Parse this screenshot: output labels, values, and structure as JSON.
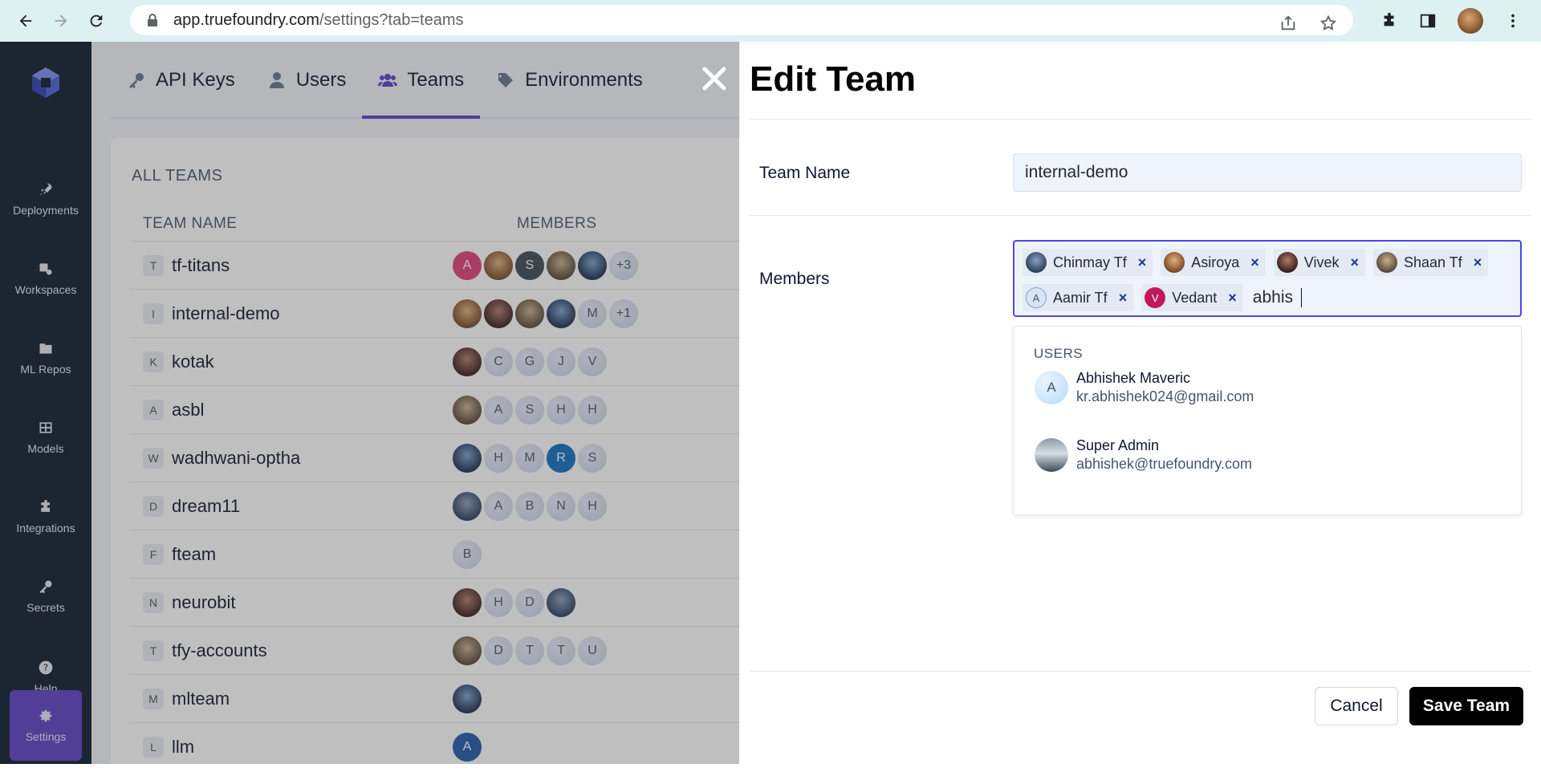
{
  "browser": {
    "url_host": "app.truefoundry.com",
    "url_path": "/settings?tab=teams"
  },
  "sidebar": {
    "items": [
      {
        "label": "Deployments",
        "icon": "rocket-icon"
      },
      {
        "label": "Workspaces",
        "icon": "workspaces-icon"
      },
      {
        "label": "ML Repos",
        "icon": "folder-icon"
      },
      {
        "label": "Models",
        "icon": "table-icon"
      },
      {
        "label": "Integrations",
        "icon": "puzzle-icon"
      },
      {
        "label": "Secrets",
        "icon": "key-icon"
      },
      {
        "label": "Help",
        "icon": "help-icon"
      },
      {
        "label": "Settings",
        "icon": "gear-icon",
        "active": true
      }
    ]
  },
  "tabs": [
    {
      "label": "API Keys",
      "icon": "key-icon"
    },
    {
      "label": "Users",
      "icon": "user-icon"
    },
    {
      "label": "Teams",
      "icon": "team-icon",
      "active": true
    },
    {
      "label": "Environments",
      "icon": "tag-icon"
    }
  ],
  "teams_panel": {
    "title": "ALL TEAMS",
    "col_team_name": "TEAM NAME",
    "col_members": "MEMBERS",
    "rows": [
      {
        "letter": "T",
        "name": "tf-titans",
        "members": [
          "A",
          "",
          "S",
          "",
          "",
          "+3"
        ]
      },
      {
        "letter": "I",
        "name": "internal-demo",
        "members": [
          "",
          "",
          "",
          "",
          "M",
          "+1"
        ]
      },
      {
        "letter": "K",
        "name": "kotak",
        "members": [
          "",
          "C",
          "G",
          "J",
          "V"
        ]
      },
      {
        "letter": "A",
        "name": "asbl",
        "members": [
          "",
          "A",
          "S",
          "H",
          "H"
        ]
      },
      {
        "letter": "W",
        "name": "wadhwani-optha",
        "members": [
          "",
          "H",
          "M",
          "R",
          "S"
        ]
      },
      {
        "letter": "D",
        "name": "dream11",
        "members": [
          "",
          "A",
          "B",
          "N",
          "H"
        ]
      },
      {
        "letter": "F",
        "name": "fteam",
        "members": [
          "B"
        ]
      },
      {
        "letter": "N",
        "name": "neurobit",
        "members": [
          "",
          "H",
          "D",
          ""
        ]
      },
      {
        "letter": "T",
        "name": "tfy-accounts",
        "members": [
          "",
          "D",
          "T",
          "T",
          "U"
        ]
      },
      {
        "letter": "M",
        "name": "mlteam",
        "members": [
          ""
        ]
      },
      {
        "letter": "L",
        "name": "llm",
        "members": [
          "A"
        ]
      }
    ]
  },
  "drawer": {
    "title": "Edit Team",
    "team_name_label": "Team Name",
    "team_name_value": "internal-demo",
    "members_label": "Members",
    "chips_row1": [
      {
        "name": "Chinmay Tf",
        "initial": ""
      },
      {
        "name": "Asiroya",
        "initial": ""
      },
      {
        "name": "Vivek",
        "initial": ""
      },
      {
        "name": "Shaan Tf",
        "initial": ""
      }
    ],
    "chips_row2": [
      {
        "name": "Aamir Tf",
        "initial": "A"
      },
      {
        "name": "Vedant",
        "initial": "V"
      }
    ],
    "typed_text": "abhis",
    "dropdown": {
      "heading": "USERS",
      "options": [
        {
          "name": "Abhishek Maveric",
          "email": "kr.abhishek024@gmail.com",
          "initial": "A"
        },
        {
          "name": "Super Admin",
          "email": "abhishek@truefoundry.com",
          "initial": ""
        }
      ]
    },
    "cancel_label": "Cancel",
    "save_label": "Save Team"
  }
}
